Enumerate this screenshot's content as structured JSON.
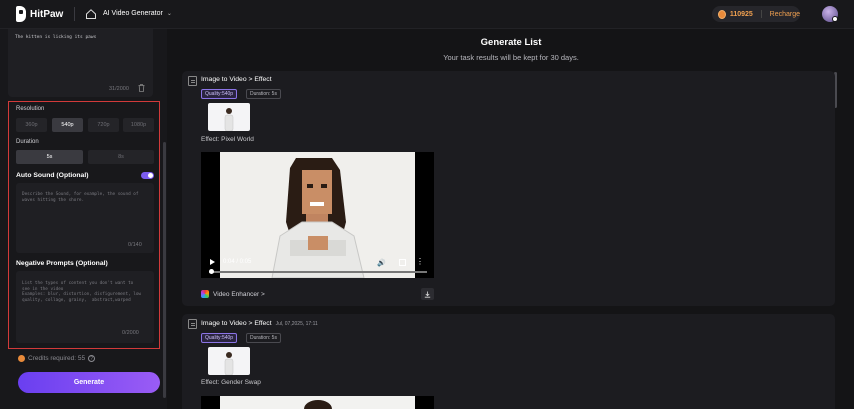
{
  "brand": {
    "name": "HitPaw"
  },
  "nav": {
    "title": "AI Video Generator"
  },
  "account": {
    "credits": "110925",
    "recharge_label": "Recharge"
  },
  "left": {
    "prompt_text": "The kitten is licking its paws",
    "prompt_counter": "31/2000",
    "resolution": {
      "label": "Resolution",
      "options": [
        "360p",
        "540p",
        "720p",
        "1080p"
      ],
      "selected": "540p"
    },
    "duration": {
      "label": "Duration",
      "options": [
        "5s",
        "8s"
      ],
      "selected": "5s"
    },
    "auto_sound": {
      "label": "Auto Sound (Optional)",
      "enabled": true,
      "placeholder": "Describe the Sound, for example, the sound of\nwaves hitting the shore.",
      "counter": "0/140"
    },
    "negative": {
      "label": "Negative Prompts (Optional)",
      "placeholder": "List the types of content you don't want to\nsee in the video\nExamples: blur, distortion, disfigurement, low\nquality, collage, grainy,  abstract,warped",
      "counter": "0/2000"
    },
    "credits_required": "Credits required: 55",
    "generate_label": "Generate"
  },
  "main": {
    "title": "Generate List",
    "subtitle": "Your task results will be kept for 30 days.",
    "cards": [
      {
        "title": "Image to Video > Effect",
        "date": "",
        "quality": "Quality:540p",
        "duration": "Duration: 5s",
        "effect": "Effect: Pixel World",
        "time": "0:04 / 0:05",
        "enhancer": "Video Enhancer >"
      },
      {
        "title": "Image to Video > Effect",
        "date": "Jul, 07,2025, 17:11",
        "quality": "Quality:540p",
        "duration": "Duration: 5s",
        "effect": "Effect: Gender Swap"
      }
    ]
  },
  "colors": {
    "accent": "#7b5cf0",
    "coin": "#f0a050",
    "frame": "#d23a3a"
  },
  "icons": [
    "home-icon",
    "chevron-down-icon",
    "coin-icon",
    "trash-icon",
    "info-icon",
    "task-icon",
    "play-icon",
    "volume-icon",
    "fullscreen-icon",
    "more-icon",
    "video-enhancer-icon",
    "download-icon"
  ]
}
